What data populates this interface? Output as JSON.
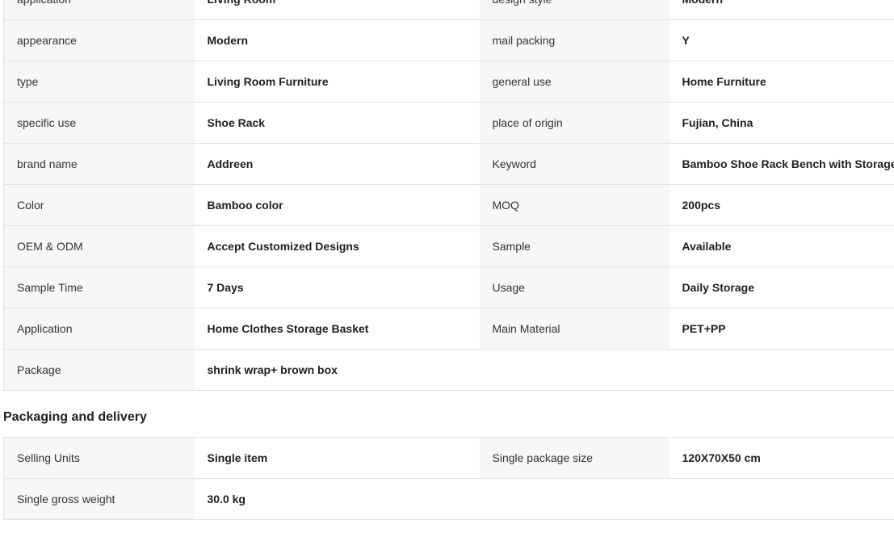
{
  "attributes": {
    "rows": [
      {
        "k1": "application",
        "v1": "Living Room",
        "k2": "design style",
        "v2": "Modern"
      },
      {
        "k1": "appearance",
        "v1": "Modern",
        "k2": "mail packing",
        "v2": "Y"
      },
      {
        "k1": "type",
        "v1": "Living Room Furniture",
        "k2": "general use",
        "v2": "Home Furniture"
      },
      {
        "k1": "specific use",
        "v1": "Shoe Rack",
        "k2": "place of origin",
        "v2": "Fujian, China"
      },
      {
        "k1": "brand name",
        "v1": "Addreen",
        "k2": "Keyword",
        "v2": "Bamboo Shoe Rack Bench with Storage"
      },
      {
        "k1": "Color",
        "v1": "Bamboo color",
        "k2": "MOQ",
        "v2": "200pcs"
      },
      {
        "k1": "OEM & ODM",
        "v1": "Accept Customized Designs",
        "k2": "Sample",
        "v2": "Available"
      },
      {
        "k1": "Sample Time",
        "v1": "7 Days",
        "k2": "Usage",
        "v2": "Daily Storage"
      },
      {
        "k1": "Application",
        "v1": "Home Clothes Storage Basket",
        "k2": "Main Material",
        "v2": "PET+PP"
      },
      {
        "k1": "Package",
        "v1": "shrink wrap+ brown box",
        "k2": "",
        "v2": ""
      }
    ]
  },
  "packaging": {
    "title": "Packaging and delivery",
    "rows": [
      {
        "k1": "Selling Units",
        "v1": "Single item",
        "k2": "Single package size",
        "v2": "120X70X50 cm"
      },
      {
        "k1": "Single gross weight",
        "v1": "30.0 kg",
        "k2": "",
        "v2": ""
      }
    ]
  }
}
